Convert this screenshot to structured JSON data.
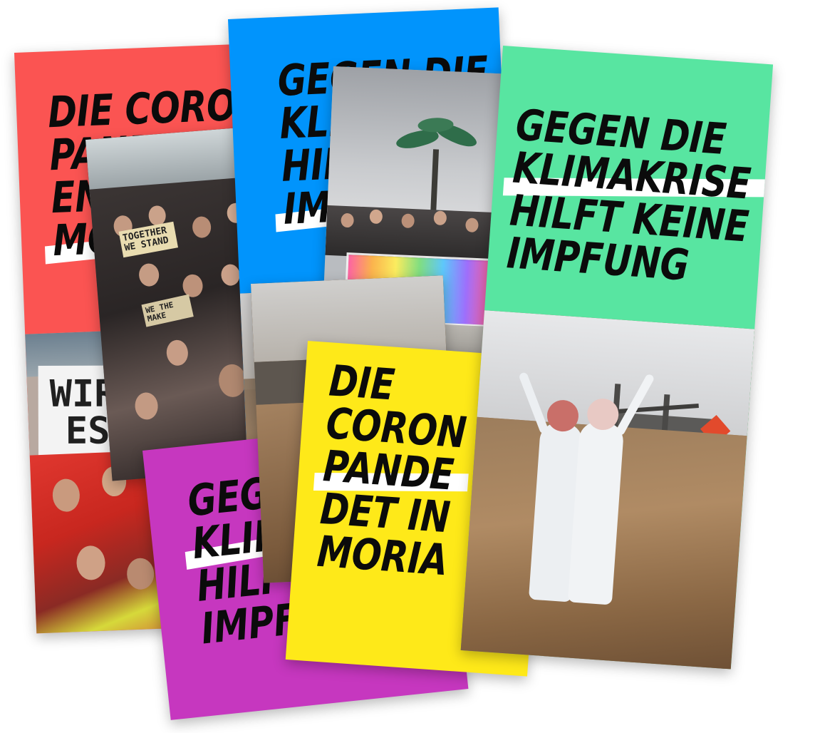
{
  "cards": [
    {
      "id": "red",
      "color": "#fb5452",
      "lines": [
        "DIE CORONA-",
        "PANDEMIE",
        "EN",
        "MO"
      ],
      "underline_line": 3
    },
    {
      "id": "blue",
      "color": "#0194fc",
      "lines": [
        "GEGEN DIE",
        "KLI",
        "HIL",
        "IM"
      ],
      "underline_line": 3
    },
    {
      "id": "purple",
      "color": "#c637bf",
      "lines": [
        "GEGEN DIE",
        "KLIMA",
        "HILFT",
        "IMPFUNG"
      ],
      "underline_line": 1
    },
    {
      "id": "yellow",
      "color": "#fee919",
      "lines": [
        "DIE",
        "CORON",
        "PANDE",
        "DET IN",
        "MORIA"
      ],
      "underline_line": 2
    },
    {
      "id": "green",
      "color": "#58e5a1",
      "lines": [
        "GEGEN DIE",
        "KLIMAKRISE",
        "HILFT KEINE",
        "IMPFUNG"
      ],
      "underline_line": 1
    }
  ],
  "photos": {
    "red_banner": [
      "WIR",
      "ES W"
    ],
    "crowd_signs": [
      "TOGETHER WE STAND",
      "WE THE MAKE"
    ]
  },
  "colors": {
    "red": "#fb5452",
    "blue": "#0194fc",
    "purple": "#c637bf",
    "yellow": "#fee919",
    "green": "#58e5a1"
  }
}
